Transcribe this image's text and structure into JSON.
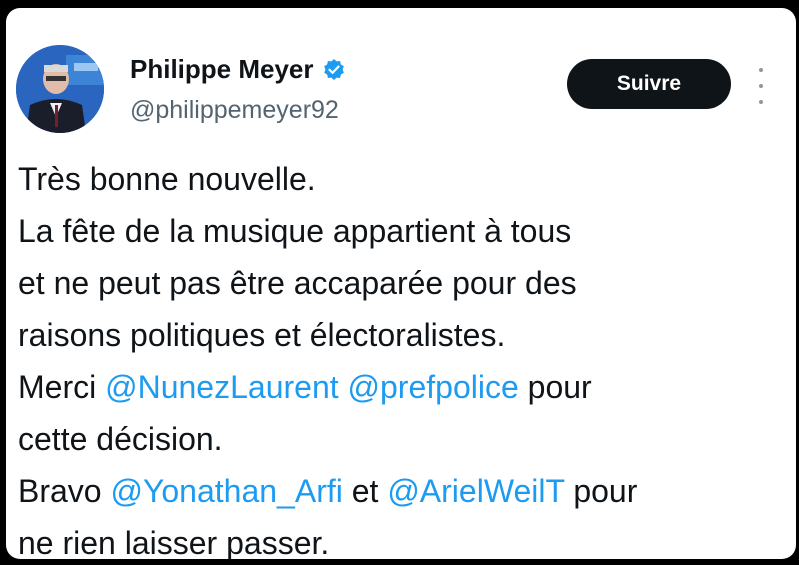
{
  "author": {
    "name": "Philippe Meyer",
    "handle": "@philippemeyer92",
    "verified_color": "#1d9bf0",
    "avatar_icon": "profile-photo"
  },
  "actions": {
    "follow_label": "Suivre",
    "more_icon": "more-vertical-icon"
  },
  "tweet": {
    "lines": [
      [
        "Très bonne nouvelle."
      ],
      [
        "La fête de la musique appartient à tous"
      ],
      [
        "et ne peut pas être accaparée pour des"
      ],
      [
        "raisons politiques et électoralistes."
      ],
      [
        "Merci ",
        "@NunezLaurent",
        " ",
        "@prefpolice",
        " pour"
      ],
      [
        "cette décision."
      ],
      [
        "Bravo ",
        "@Yonathan_Arfi",
        " et ",
        "@ArielWeilT",
        " pour"
      ],
      [
        "ne rien laisser passer."
      ]
    ]
  },
  "colors": {
    "mention": "#1d9bf0",
    "text": "#0f1419",
    "handle": "#536471",
    "button_bg": "#0f1419"
  }
}
